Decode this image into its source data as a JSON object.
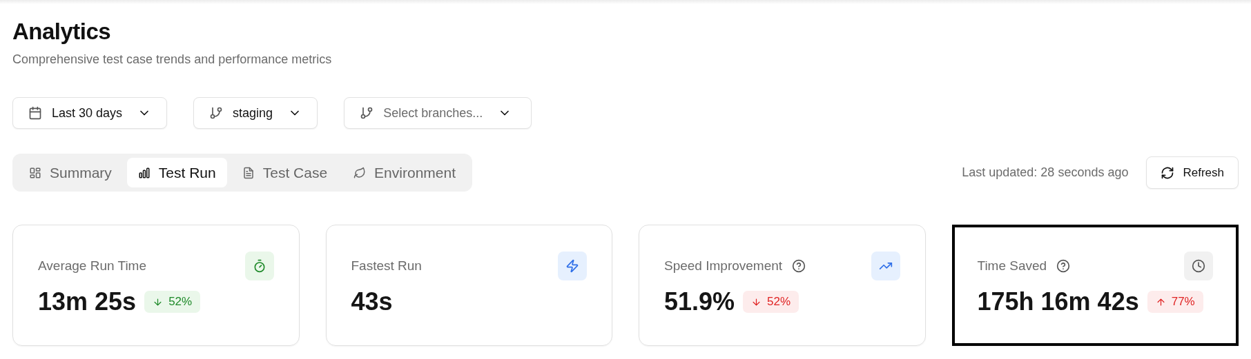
{
  "header": {
    "title": "Analytics",
    "subtitle": "Comprehensive test case trends and performance metrics"
  },
  "filters": [
    {
      "kind": "date",
      "label": "Last 30 days",
      "placeholder": false
    },
    {
      "kind": "branch",
      "label": "staging",
      "placeholder": false
    },
    {
      "kind": "branch",
      "label": "Select branches...",
      "placeholder": true
    }
  ],
  "tabs": [
    {
      "kind": "summary",
      "label": "Summary",
      "selected": false
    },
    {
      "kind": "run",
      "label": "Test Run",
      "selected": true
    },
    {
      "kind": "case",
      "label": "Test Case",
      "selected": false
    },
    {
      "kind": "environment",
      "label": "Environment",
      "selected": false
    }
  ],
  "last_updated": "Last updated: 28 seconds ago",
  "refresh_button": "Refresh",
  "cards": [
    {
      "title": "Average Run Time",
      "help": false,
      "value": "13m 25s",
      "delta": {
        "text": "52%",
        "increase": false,
        "favorable": true
      },
      "highlighted": false
    },
    {
      "title": "Fastest Run",
      "help": false,
      "value": "43s",
      "highlighted": false
    },
    {
      "title": "Speed Improvement",
      "help": true,
      "value": "51.9%",
      "delta": {
        "text": "52%",
        "increase": false,
        "favorable": false
      },
      "highlighted": false
    },
    {
      "title": "Time Saved",
      "help": true,
      "value": "175h 16m 42s",
      "delta": {
        "text": "77%",
        "increase": true,
        "favorable": false
      },
      "highlighted": true
    }
  ]
}
